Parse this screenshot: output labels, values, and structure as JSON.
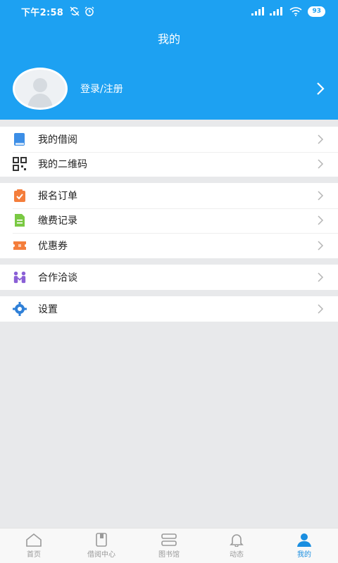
{
  "status_bar": {
    "time": "下午2:58",
    "battery": "93"
  },
  "header": {
    "title": "我的",
    "login_label": "登录/注册"
  },
  "menu_groups": [
    [
      {
        "label": "我的借阅",
        "icon": "book-icon",
        "color": "#3c8ee6"
      },
      {
        "label": "我的二维码",
        "icon": "qr-code-icon",
        "color": "#333333"
      }
    ],
    [
      {
        "label": "报名订单",
        "icon": "clipboard-check-icon",
        "color": "#f47e3c"
      },
      {
        "label": "缴费记录",
        "icon": "document-icon",
        "color": "#7ac943"
      },
      {
        "label": "优惠券",
        "icon": "coupon-icon",
        "color": "#f47e3c"
      }
    ],
    [
      {
        "label": "合作洽谈",
        "icon": "handshake-people-icon",
        "color": "#8a5fd6"
      }
    ],
    [
      {
        "label": "设置",
        "icon": "gear-icon",
        "color": "#2f80d8"
      }
    ]
  ],
  "tab_bar": [
    {
      "label": "首页",
      "icon": "home-icon",
      "active": false
    },
    {
      "label": "借阅中心",
      "icon": "borrow-book-icon",
      "active": false
    },
    {
      "label": "图书馆",
      "icon": "library-icon",
      "active": false
    },
    {
      "label": "动态",
      "icon": "bell-icon",
      "active": false
    },
    {
      "label": "我的",
      "icon": "user-icon",
      "active": true
    }
  ],
  "colors": {
    "primary": "#1da1f2",
    "active_tab": "#1a8ee0",
    "background": "#e8e9eb"
  }
}
